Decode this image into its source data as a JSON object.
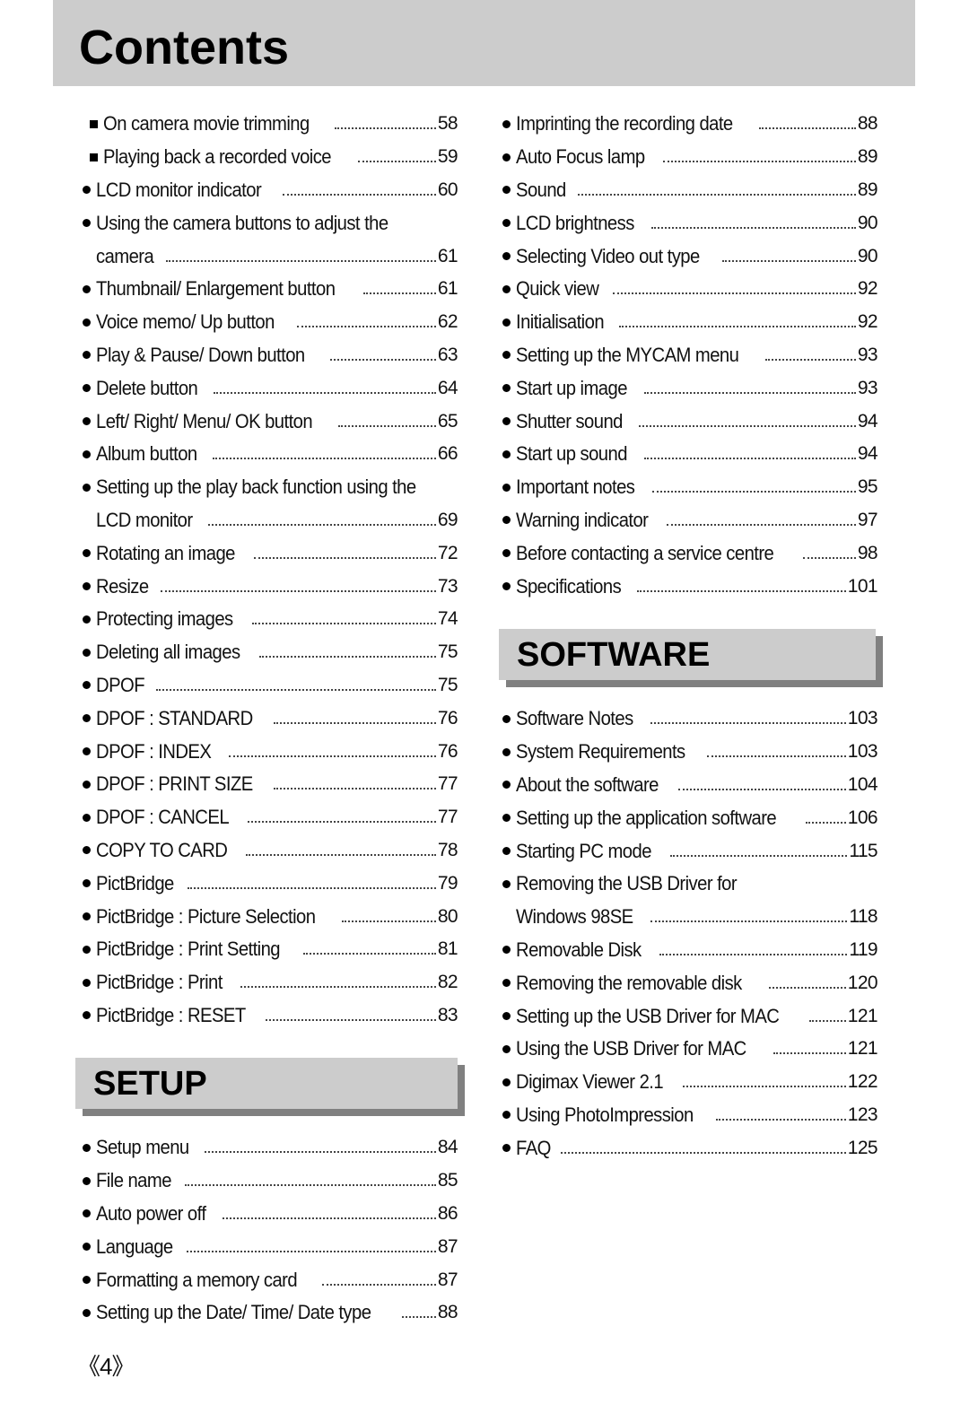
{
  "header": {
    "title": "Contents"
  },
  "left_column": {
    "entries": [
      {
        "bullet": "square",
        "lines": [
          "On camera movie trimming"
        ],
        "page": "58"
      },
      {
        "bullet": "square",
        "lines": [
          "Playing back a recorded voice"
        ],
        "page": "59"
      },
      {
        "bullet": "circle",
        "lines": [
          "LCD monitor indicator"
        ],
        "page": "60"
      },
      {
        "bullet": "circle",
        "lines": [
          "Using the camera buttons to adjust the",
          "camera"
        ],
        "page": "61"
      },
      {
        "bullet": "circle",
        "lines": [
          "Thumbnail/ Enlargement button"
        ],
        "page": "61"
      },
      {
        "bullet": "circle",
        "lines": [
          "Voice memo/ Up button"
        ],
        "page": "62"
      },
      {
        "bullet": "circle",
        "lines": [
          "Play & Pause/ Down button"
        ],
        "page": "63"
      },
      {
        "bullet": "circle",
        "lines": [
          "Delete button"
        ],
        "page": "64"
      },
      {
        "bullet": "circle",
        "lines": [
          "Left/ Right/ Menu/ OK button"
        ],
        "page": "65"
      },
      {
        "bullet": "circle",
        "lines": [
          "Album button"
        ],
        "page": "66"
      },
      {
        "bullet": "circle",
        "lines": [
          "Setting up the play back function using the",
          "LCD monitor"
        ],
        "page": "69"
      },
      {
        "bullet": "circle",
        "lines": [
          "Rotating an image"
        ],
        "page": "72"
      },
      {
        "bullet": "circle",
        "lines": [
          "Resize"
        ],
        "page": "73"
      },
      {
        "bullet": "circle",
        "lines": [
          "Protecting images"
        ],
        "page": "74"
      },
      {
        "bullet": "circle",
        "lines": [
          "Deleting all images"
        ],
        "page": "75"
      },
      {
        "bullet": "circle",
        "lines": [
          "DPOF"
        ],
        "page": "75"
      },
      {
        "bullet": "circle",
        "lines": [
          "DPOF : STANDARD"
        ],
        "page": "76"
      },
      {
        "bullet": "circle",
        "lines": [
          "DPOF : INDEX"
        ],
        "page": "76"
      },
      {
        "bullet": "circle",
        "lines": [
          "DPOF : PRINT SIZE"
        ],
        "page": "77"
      },
      {
        "bullet": "circle",
        "lines": [
          "DPOF : CANCEL"
        ],
        "page": "77"
      },
      {
        "bullet": "circle",
        "lines": [
          "COPY TO CARD"
        ],
        "page": "78"
      },
      {
        "bullet": "circle",
        "lines": [
          "PictBridge"
        ],
        "page": "79"
      },
      {
        "bullet": "circle",
        "lines": [
          "PictBridge : Picture Selection"
        ],
        "page": "80"
      },
      {
        "bullet": "circle",
        "lines": [
          "PictBridge : Print Setting"
        ],
        "page": "81"
      },
      {
        "bullet": "circle",
        "lines": [
          "PictBridge : Print"
        ],
        "page": "82"
      },
      {
        "bullet": "circle",
        "lines": [
          "PictBridge : RESET"
        ],
        "page": "83"
      }
    ]
  },
  "setup_section": {
    "heading": "SETUP",
    "entries": [
      {
        "bullet": "circle",
        "lines": [
          "Setup menu"
        ],
        "page": "84"
      },
      {
        "bullet": "circle",
        "lines": [
          "File name"
        ],
        "page": "85"
      },
      {
        "bullet": "circle",
        "lines": [
          "Auto power off"
        ],
        "page": "86"
      },
      {
        "bullet": "circle",
        "lines": [
          "Language"
        ],
        "page": "87"
      },
      {
        "bullet": "circle",
        "lines": [
          "Formatting a memory card"
        ],
        "page": "87"
      },
      {
        "bullet": "circle",
        "lines": [
          "Setting up the Date/ Time/ Date type"
        ],
        "page": "88"
      }
    ]
  },
  "right_column": {
    "entries": [
      {
        "bullet": "circle",
        "lines": [
          "Imprinting the recording date"
        ],
        "page": "88"
      },
      {
        "bullet": "circle",
        "lines": [
          "Auto Focus lamp"
        ],
        "page": "89"
      },
      {
        "bullet": "circle",
        "lines": [
          "Sound"
        ],
        "page": "89"
      },
      {
        "bullet": "circle",
        "lines": [
          "LCD brightness"
        ],
        "page": "90"
      },
      {
        "bullet": "circle",
        "lines": [
          "Selecting Video out type"
        ],
        "page": "90"
      },
      {
        "bullet": "circle",
        "lines": [
          "Quick view"
        ],
        "page": "92"
      },
      {
        "bullet": "circle",
        "lines": [
          "Initialisation"
        ],
        "page": "92"
      },
      {
        "bullet": "circle",
        "lines": [
          "Setting up the MYCAM menu"
        ],
        "page": "93"
      },
      {
        "bullet": "circle",
        "lines": [
          "Start up image"
        ],
        "page": "93"
      },
      {
        "bullet": "circle",
        "lines": [
          "Shutter sound"
        ],
        "page": "94"
      },
      {
        "bullet": "circle",
        "lines": [
          "Start up sound"
        ],
        "page": "94"
      },
      {
        "bullet": "circle",
        "lines": [
          "Important notes"
        ],
        "page": "95"
      },
      {
        "bullet": "circle",
        "lines": [
          "Warning indicator"
        ],
        "page": "97"
      },
      {
        "bullet": "circle",
        "lines": [
          "Before contacting a service centre"
        ],
        "page": "98"
      },
      {
        "bullet": "circle",
        "lines": [
          "Specifications"
        ],
        "page": "101"
      }
    ]
  },
  "software_section": {
    "heading": "SOFTWARE",
    "entries": [
      {
        "bullet": "circle",
        "lines": [
          "Software Notes"
        ],
        "page": "103"
      },
      {
        "bullet": "circle",
        "lines": [
          "System Requirements"
        ],
        "page": "103"
      },
      {
        "bullet": "circle",
        "lines": [
          "About the software"
        ],
        "page": "104"
      },
      {
        "bullet": "circle",
        "lines": [
          "Setting up the application software"
        ],
        "page": "106"
      },
      {
        "bullet": "circle",
        "lines": [
          "Starting PC mode"
        ],
        "page": "115"
      },
      {
        "bullet": "circle",
        "lines": [
          "Removing the USB Driver for",
          "Windows 98SE"
        ],
        "page": "118"
      },
      {
        "bullet": "circle",
        "lines": [
          "Removable Disk"
        ],
        "page": "119"
      },
      {
        "bullet": "circle",
        "lines": [
          "Removing the removable disk"
        ],
        "page": "120"
      },
      {
        "bullet": "circle",
        "lines": [
          "Setting up the USB Driver for MAC"
        ],
        "page": "121"
      },
      {
        "bullet": "circle",
        "lines": [
          "Using the USB Driver for MAC"
        ],
        "page": "121"
      },
      {
        "bullet": "circle",
        "lines": [
          "Digimax Viewer 2.1"
        ],
        "page": "122"
      },
      {
        "bullet": "circle",
        "lines": [
          "Using PhotoImpression"
        ],
        "page": "123"
      },
      {
        "bullet": "circle",
        "lines": [
          "FAQ"
        ],
        "page": "125"
      }
    ]
  },
  "footer": {
    "page_number": "《4》"
  }
}
